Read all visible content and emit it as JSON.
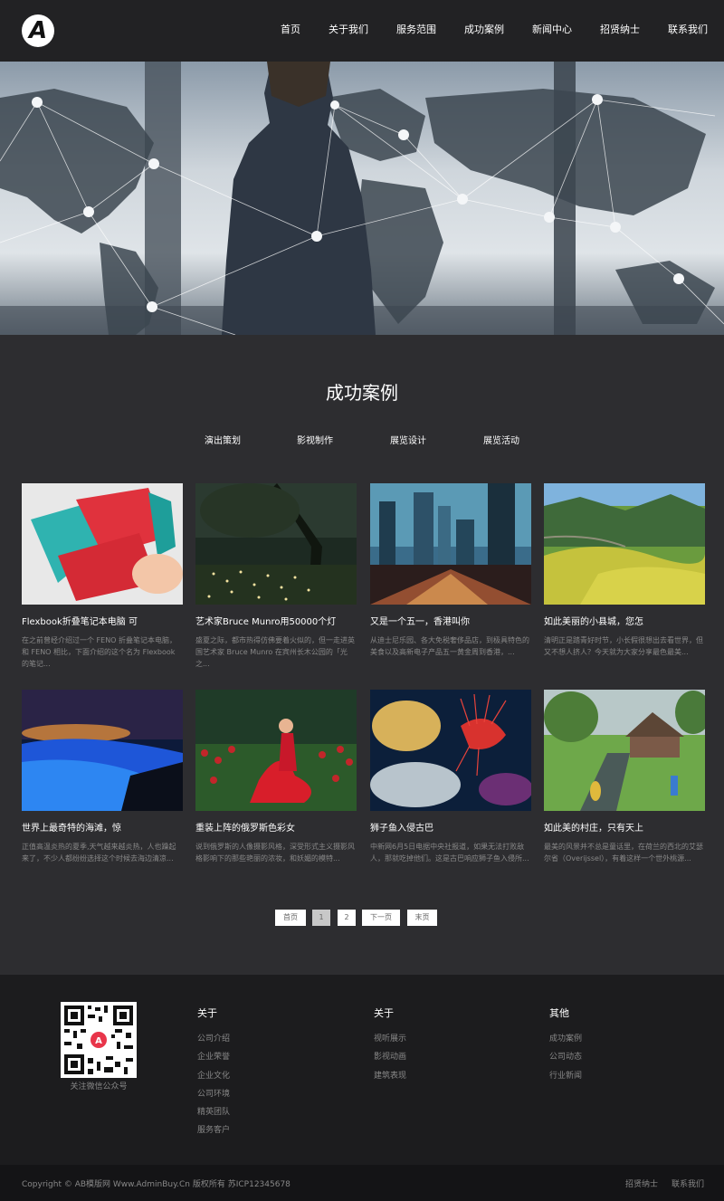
{
  "header": {
    "logo_letter": "A",
    "nav": [
      "首页",
      "关于我们",
      "服务范围",
      "成功案例",
      "新闻中心",
      "招贤纳士",
      "联系我们"
    ]
  },
  "main": {
    "title": "成功案例",
    "tabs": [
      "演出策划",
      "影视制作",
      "展览设计",
      "展览活动"
    ],
    "cases": [
      {
        "title": "Flexbook折叠笔记本电脑 可",
        "desc": "在之前曾经介绍过一个 FENO 折叠笔记本电脑，和 FENO 相比，下面介绍的这个名为 Flexbook 的笔记..."
      },
      {
        "title": "艺术家Bruce Munro用50000个灯",
        "desc": "盛夏之际，都市热得仿佛要着火似的，但一走进英国艺术家 Bruce Munro 在宾州长木公园的「光之..."
      },
      {
        "title": "又是一个五一，香港叫你",
        "desc": "从迪士尼乐园、各大免税奢侈品店，到极具特色的美食以及高新电子产品五一黄金周到香港，..."
      },
      {
        "title": "如此美丽的小县城，您怎",
        "desc": "清明正是踏青好时节，小长假很想出去看世界，但又不想人挤人？今天就为大家分享最色最美..."
      },
      {
        "title": "世界上最奇特的海滩，惊",
        "desc": "正值高温炎热的夏季,天气越来越炎热，人也躁起来了，不少人都纷纷选择这个时候去海边清凉..."
      },
      {
        "title": "重装上阵的俄罗斯色彩女",
        "desc": "说到俄罗斯的人像摄影风格，深受形式主义摄影风格影响下的那些艳丽的浓妆，和妖媚的模特..."
      },
      {
        "title": "狮子鱼入侵古巴",
        "desc": "中新网6月5日电据中央社报道，如果无法打败敌人，那就吃掉他们。这是古巴响应狮子鱼入侵所..."
      },
      {
        "title": "如此美的村庄，只有天上",
        "desc": "最美的风景并不总是童话里，在荷兰的西北的艾瑟尔省（Overijssel），有着这样一个世外桃源..."
      }
    ],
    "pager": [
      "首页",
      "1",
      "2",
      "下一页",
      "末页"
    ]
  },
  "footer": {
    "qr_caption": "关注微信公众号",
    "columns": [
      {
        "heading": "关于",
        "links": [
          "公司介绍",
          "企业荣誉",
          "企业文化",
          "公司环境",
          "精英团队",
          "服务客户"
        ]
      },
      {
        "heading": "关于",
        "links": [
          "视听展示",
          "影视动画",
          "建筑表现"
        ]
      },
      {
        "heading": "其他",
        "links": [
          "成功案例",
          "公司动态",
          "行业新闻"
        ]
      }
    ]
  },
  "bottom": {
    "copyright": "Copyright © AB模版网 Www.AdminBuy.Cn 版权所有    苏ICP12345678",
    "links": [
      "招贤纳士",
      "联系我们"
    ]
  }
}
